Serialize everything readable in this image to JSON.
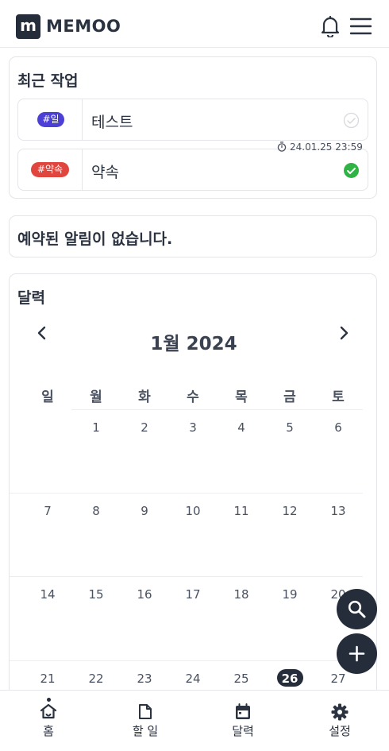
{
  "header": {
    "logo_letter": "m",
    "app_name": "MEMOO"
  },
  "recent": {
    "title": "최근 작업",
    "tasks": [
      {
        "tag": "#일",
        "tag_color": "#4b3fd6",
        "title": "테스트",
        "done": false
      },
      {
        "tag": "#약속",
        "tag_color": "#e0453e",
        "title": "약속",
        "done": true,
        "due": "24.01.25 23:59"
      }
    ]
  },
  "alarms": {
    "empty_text": "예약된 알림이 없습니다."
  },
  "calendar": {
    "title": "달력",
    "month_label": "1월 2024",
    "weekdays": [
      "일",
      "월",
      "화",
      "수",
      "목",
      "금",
      "토"
    ],
    "weeks": [
      [
        "",
        "1",
        "2",
        "3",
        "4",
        "5",
        "6"
      ],
      [
        "7",
        "8",
        "9",
        "10",
        "11",
        "12",
        "13"
      ],
      [
        "14",
        "15",
        "16",
        "17",
        "18",
        "19",
        "20"
      ],
      [
        "21",
        "22",
        "23",
        "24",
        "25",
        "26",
        "27"
      ]
    ],
    "today": "26"
  },
  "nav": {
    "items": [
      {
        "label": "홈",
        "icon": "home-icon",
        "active": true
      },
      {
        "label": "할 일",
        "icon": "document-icon",
        "active": false
      },
      {
        "label": "달력",
        "icon": "calendar-icon",
        "active": false
      },
      {
        "label": "설정",
        "icon": "gear-icon",
        "active": false
      }
    ]
  },
  "colors": {
    "primary": "#252c3a",
    "tag_work": "#4b3fd6",
    "tag_appointment": "#e0453e",
    "done_green": "#2fb344"
  }
}
